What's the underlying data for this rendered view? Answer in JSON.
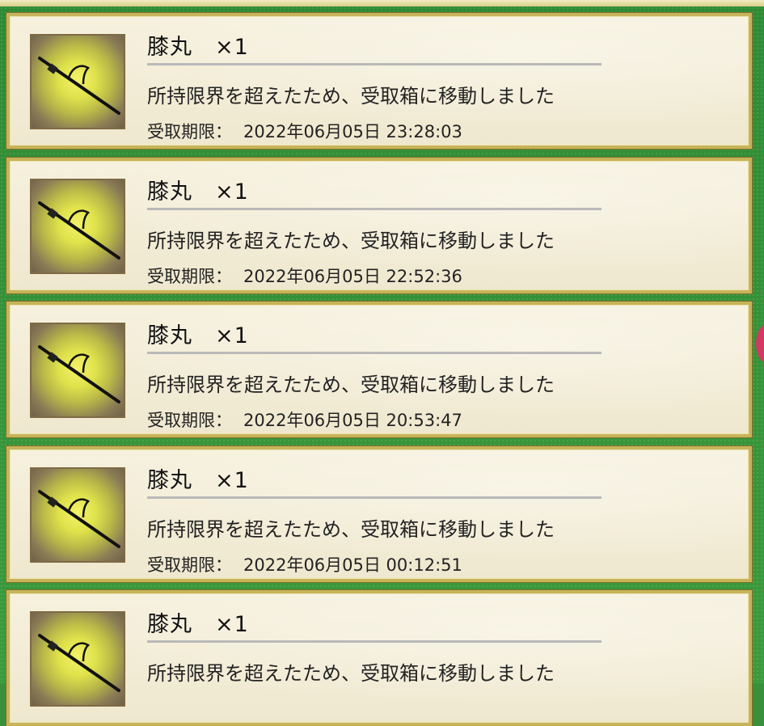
{
  "colors": {
    "frame_green": "#3a8f3a",
    "card_border_gold": "#c7b45a",
    "card_bg": "#f4efd9",
    "accent_pink": "#d23a63"
  },
  "items": [
    {
      "title": "膝丸　×1",
      "message": "所持限界を超えたため、受取箱に移動しました",
      "expiry_label": "受取期限：",
      "expiry_value": "2022年06月05日 23:28:03",
      "icon": "tachi-sword-icon"
    },
    {
      "title": "膝丸　×1",
      "message": "所持限界を超えたため、受取箱に移動しました",
      "expiry_label": "受取期限：",
      "expiry_value": "2022年06月05日 22:52:36",
      "icon": "tachi-sword-icon"
    },
    {
      "title": "膝丸　×1",
      "message": "所持限界を超えたため、受取箱に移動しました",
      "expiry_label": "受取期限：",
      "expiry_value": "2022年06月05日 20:53:47",
      "icon": "tachi-sword-icon"
    },
    {
      "title": "膝丸　×1",
      "message": "所持限界を超えたため、受取箱に移動しました",
      "expiry_label": "受取期限：",
      "expiry_value": "2022年06月05日 00:12:51",
      "icon": "tachi-sword-icon"
    },
    {
      "title": "膝丸　×1",
      "message": "所持限界を超えたため、受取箱に移動しました",
      "expiry_label": "",
      "expiry_value": "",
      "icon": "tachi-sword-icon"
    }
  ]
}
